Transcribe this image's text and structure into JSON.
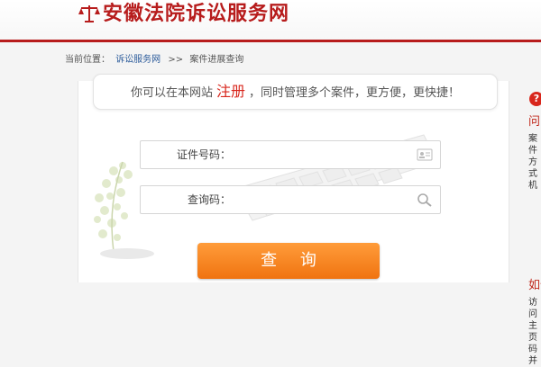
{
  "header": {
    "site_title": "安徽法院诉讼服务网"
  },
  "breadcrumb": {
    "prefix": "当前位置：",
    "home": "诉讼服务网",
    "separator": ">>",
    "current": "案件进展查询"
  },
  "banner": {
    "text_before": "你可以在本网站",
    "register": "注册",
    "text_after": "，同时管理多个案件，更方便，更快捷！"
  },
  "form": {
    "id_label": "证件号码：",
    "id_value": "",
    "code_label": "查询码：",
    "code_value": "",
    "submit": "查 询"
  },
  "side": {
    "q1_title": "问",
    "q1_text": "案件方式机",
    "q2_title": "如何",
    "q2_text": "访问主页码并"
  },
  "colors": {
    "brand_red": "#b71c1c",
    "button_orange": "#f58220",
    "link_blue": "#2d5c9b"
  },
  "icons": [
    "scales-icon",
    "id-card-icon",
    "magnifier-icon",
    "help-icon"
  ]
}
